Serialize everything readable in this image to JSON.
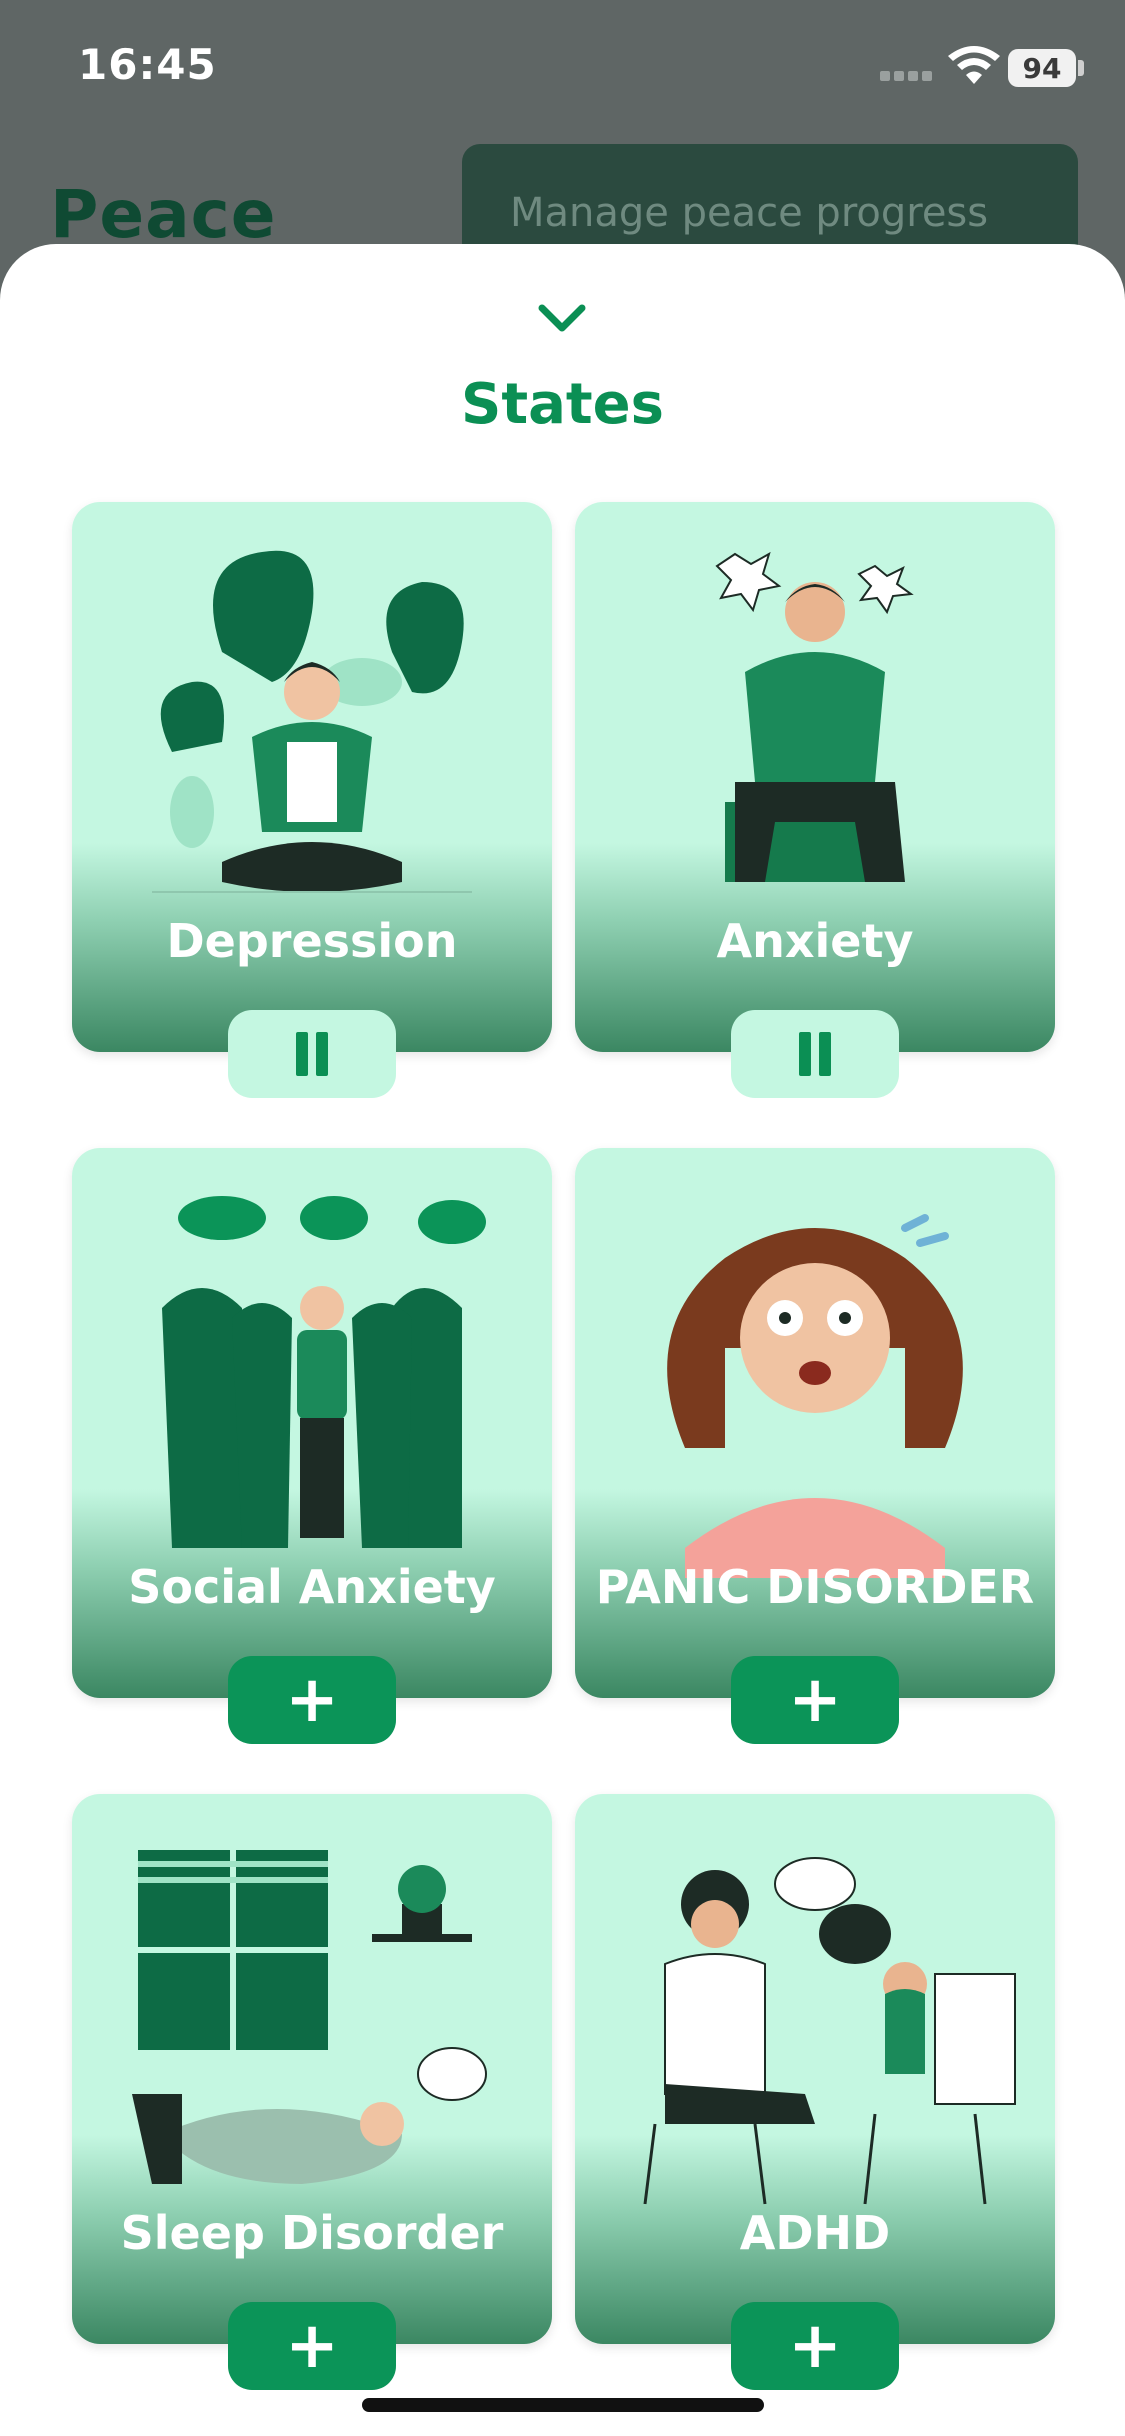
{
  "status_bar": {
    "time": "16:45",
    "battery": "94"
  },
  "background": {
    "title": "Peace",
    "manage_button": "Manage peace progress"
  },
  "sheet": {
    "title": "States",
    "cards": [
      {
        "label": "Depression",
        "action": "pause"
      },
      {
        "label": "Anxiety",
        "action": "pause"
      },
      {
        "label": "Social Anxiety",
        "action": "add"
      },
      {
        "label": "PANIC DISORDER",
        "action": "add"
      },
      {
        "label": "Sleep Disorder",
        "action": "add"
      },
      {
        "label": "ADHD",
        "action": "add"
      }
    ]
  },
  "colors": {
    "accent": "#0b8f54",
    "card_bg": "#c4f7e1",
    "card_dark": "#3b8762",
    "dark_green": "#0f4a33"
  }
}
